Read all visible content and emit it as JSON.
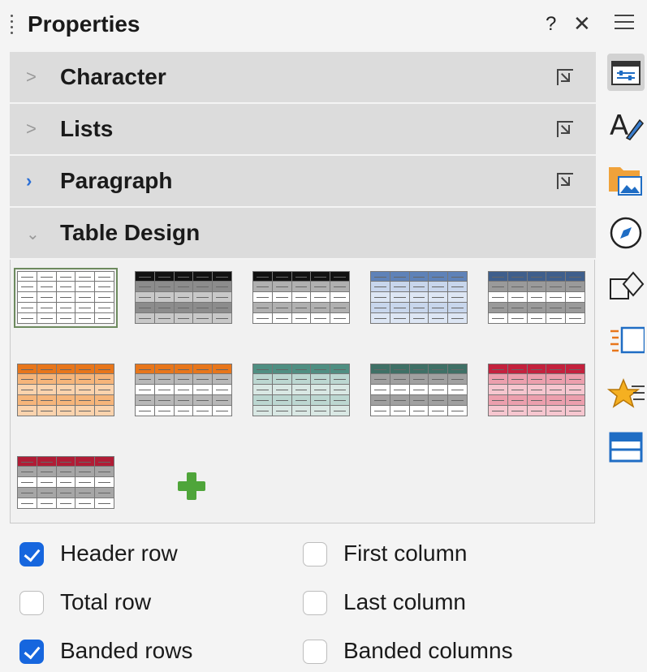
{
  "header": {
    "title": "Properties",
    "help_label": "?",
    "close_label": "✕"
  },
  "sections": [
    {
      "label": "Character",
      "expanded": false,
      "active": false
    },
    {
      "label": "Lists",
      "expanded": false,
      "active": false
    },
    {
      "label": "Paragraph",
      "expanded": false,
      "active": true
    },
    {
      "label": "Table Design",
      "expanded": true,
      "active": false
    }
  ],
  "table_styles": [
    {
      "header": "#ffffff",
      "band": "#ffffff",
      "body": "#ffffff",
      "selected": true
    },
    {
      "header": "#111111",
      "band": "#8c8c8c",
      "body": "#c8c8c8",
      "selected": false
    },
    {
      "header": "#111111",
      "band": "#b0b0b0",
      "body": "#ffffff",
      "selected": false
    },
    {
      "header": "#5f82b8",
      "band": "#c8d6ec",
      "body": "#dde6f4",
      "selected": false
    },
    {
      "header": "#3f5f8c",
      "band": "#9a9a9a",
      "body": "#ffffff",
      "selected": false
    },
    {
      "header": "#e8761b",
      "band": "#f6b57a",
      "body": "#fbd3ad",
      "selected": false
    },
    {
      "header": "#e8761b",
      "band": "#b8b8b8",
      "body": "#ffffff",
      "selected": false
    },
    {
      "header": "#4f8f82",
      "band": "#bcd7d1",
      "body": "#d9e8e4",
      "selected": false
    },
    {
      "header": "#3f7066",
      "band": "#a0a0a0",
      "body": "#ffffff",
      "selected": false
    },
    {
      "header": "#c4213d",
      "band": "#ec9fad",
      "body": "#f6c6cf",
      "selected": false
    },
    {
      "header": "#b01c35",
      "band": "#a6a6a6",
      "body": "#ffffff",
      "selected": false
    }
  ],
  "options": [
    {
      "label": "Header row",
      "checked": true
    },
    {
      "label": "First column",
      "checked": false
    },
    {
      "label": "Total row",
      "checked": false
    },
    {
      "label": "Last column",
      "checked": false
    },
    {
      "label": "Banded rows",
      "checked": true
    },
    {
      "label": "Banded columns",
      "checked": false
    }
  ],
  "sidebar_icons": [
    "properties-icon",
    "styles-icon",
    "gallery-icon",
    "navigator-icon",
    "shapes-icon",
    "page-icon",
    "style-inspector-icon",
    "manage-changes-icon"
  ],
  "colors": {
    "accent": "#1666de",
    "section_bg": "#dcdcdc",
    "add_green": "#4fa53a"
  }
}
